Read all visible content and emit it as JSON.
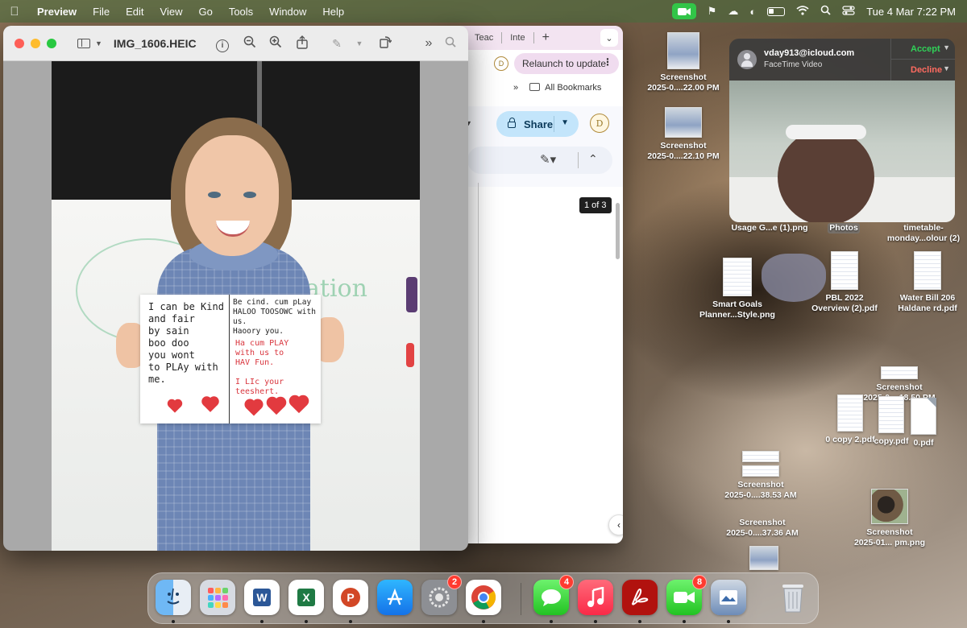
{
  "menubar": {
    "app_name": "Preview",
    "items": [
      "File",
      "Edit",
      "View",
      "Go",
      "Tools",
      "Window",
      "Help"
    ],
    "clock": "Tue 4 Mar  7:22 PM"
  },
  "preview": {
    "title": "IMG_1606.HEIC",
    "card": {
      "left_text": "I can be Kind\nand fair\nby sain\nboo doo\nyou wont\nto PLAy with\nme.",
      "right_top": "Be cind.  cum pLay\nHALOO TOOSOWC with us.\nHaoory you.",
      "right_red": "Ha cum PLAY\nwith us to\nHAV Fun.\n\nI LIc your\nteeshert."
    },
    "board_text": "ation"
  },
  "chrome": {
    "tabs": [
      "Teac",
      "Inte"
    ],
    "relaunch_label": "Relaunch to update",
    "all_bookmarks": "All Bookmarks",
    "share_label": "Share",
    "page_count": "1 of 3"
  },
  "facetime": {
    "caller": "vday913@icloud.com",
    "call_type": "FaceTime Video",
    "accept": "Accept",
    "decline": "Decline"
  },
  "desktop_icons": [
    {
      "label1": "Screenshot",
      "label2": "2025-0....22.00 PM"
    },
    {
      "label1": "Screenshot",
      "label2": "2025-0....22.10 PM"
    },
    {
      "label1": "Usage G...e (1).png",
      "label2": ""
    },
    {
      "label1": "Photos",
      "label2": ""
    },
    {
      "label1": "timetable-",
      "label2": "monday...olour (2)"
    },
    {
      "label1": "Smart Goals",
      "label2": "Planner...Style.png"
    },
    {
      "label1": "PBL 2022",
      "label2": "Overview (2).pdf"
    },
    {
      "label1": "Water Bill 206",
      "label2": "Haldane rd.pdf"
    },
    {
      "label1": "Screenshot",
      "label2": "2025-0....18.50 PM"
    },
    {
      "label1": "0 copy 2.pdf",
      "label2": ""
    },
    {
      "label1": "copy.pdf",
      "label2": ""
    },
    {
      "label1": "0.pdf",
      "label2": ""
    },
    {
      "label1": "Screenshot",
      "label2": "2025-0....38.53 AM"
    },
    {
      "label1": "Screenshot",
      "label2": "2025-0....37.36 AM"
    },
    {
      "label1": "Screenshot",
      "label2": "2025-01... pm.png"
    }
  ],
  "dock": {
    "apps": [
      {
        "name": "Finder",
        "badge": ""
      },
      {
        "name": "Launchpad",
        "badge": ""
      },
      {
        "name": "Word",
        "glyph": "W",
        "badge": ""
      },
      {
        "name": "Excel",
        "glyph": "X",
        "badge": ""
      },
      {
        "name": "PowerPoint",
        "glyph": "P",
        "badge": ""
      },
      {
        "name": "App Store",
        "badge": ""
      },
      {
        "name": "System Settings",
        "badge": "2"
      },
      {
        "name": "Chrome",
        "badge": ""
      },
      {
        "name": "Messages",
        "badge": "4"
      },
      {
        "name": "Music",
        "badge": ""
      },
      {
        "name": "Acrobat",
        "badge": ""
      },
      {
        "name": "FaceTime",
        "badge": "8"
      },
      {
        "name": "Preview",
        "badge": ""
      },
      {
        "name": "Trash",
        "badge": ""
      }
    ]
  },
  "colors": {
    "accept": "#30d158",
    "decline": "#ff6b60",
    "badge": "#ff3b30",
    "share": "#c3e5fb"
  }
}
